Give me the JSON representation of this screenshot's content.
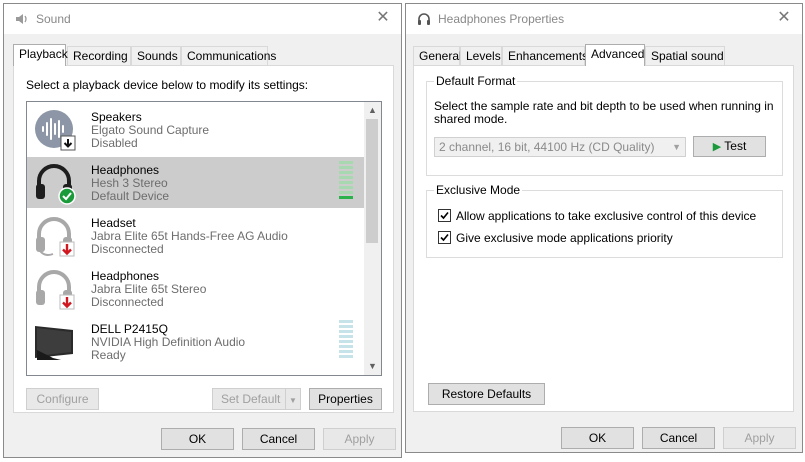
{
  "sound_dialog": {
    "title": "Sound",
    "tabs": [
      {
        "label": "Playback"
      },
      {
        "label": "Recording"
      },
      {
        "label": "Sounds"
      },
      {
        "label": "Communications"
      }
    ],
    "instruction": "Select a playback device below to modify its settings:",
    "devices": [
      {
        "name": "Speakers",
        "description": "Elgato Sound Capture",
        "status": "Disabled",
        "icon": "speaker-waveform-icon",
        "badge": "disabled-down-arrow-icon",
        "selected": false
      },
      {
        "name": "Headphones",
        "description": "Hesh 3 Stereo",
        "status": "Default Device",
        "icon": "headphones-icon",
        "badge": "default-check-icon",
        "selected": true
      },
      {
        "name": "Headset",
        "description": "Jabra Elite 65t Hands-Free AG Audio",
        "status": "Disconnected",
        "icon": "headset-icon",
        "badge": "disconnected-red-arrow-icon",
        "selected": false
      },
      {
        "name": "Headphones",
        "description": "Jabra Elite 65t Stereo",
        "status": "Disconnected",
        "icon": "headphones-icon",
        "badge": "disconnected-red-arrow-icon",
        "selected": false
      },
      {
        "name": "DELL P2415Q",
        "description": "NVIDIA High Definition Audio",
        "status": "Ready",
        "icon": "monitor-icon",
        "badge": "",
        "selected": false
      }
    ],
    "buttons": {
      "configure": "Configure",
      "set_default": "Set Default",
      "properties": "Properties",
      "ok": "OK",
      "cancel": "Cancel",
      "apply": "Apply"
    }
  },
  "properties_dialog": {
    "title": "Headphones Properties",
    "tabs": [
      {
        "label": "General"
      },
      {
        "label": "Levels"
      },
      {
        "label": "Enhancements"
      },
      {
        "label": "Advanced"
      },
      {
        "label": "Spatial sound"
      }
    ],
    "active_tab": "Advanced",
    "default_format": {
      "group_title": "Default Format",
      "description": "Select the sample rate and bit depth to be used when running in shared mode.",
      "selected_format": "2 channel, 16 bit, 44100 Hz (CD Quality)",
      "test_button": "Test"
    },
    "exclusive_mode": {
      "group_title": "Exclusive Mode",
      "options": [
        {
          "label": "Allow applications to take exclusive control of this device",
          "checked": true
        },
        {
          "label": "Give exclusive mode applications priority",
          "checked": true
        }
      ]
    },
    "buttons": {
      "restore_defaults": "Restore Defaults",
      "ok": "OK",
      "cancel": "Cancel",
      "apply": "Apply"
    }
  },
  "colors": {
    "accent": "#0078d7",
    "selected_row": "#cccccc",
    "check_green": "#1a9a3a",
    "disconnect_red": "#d0161f",
    "meter_green": "#2bb24c"
  }
}
